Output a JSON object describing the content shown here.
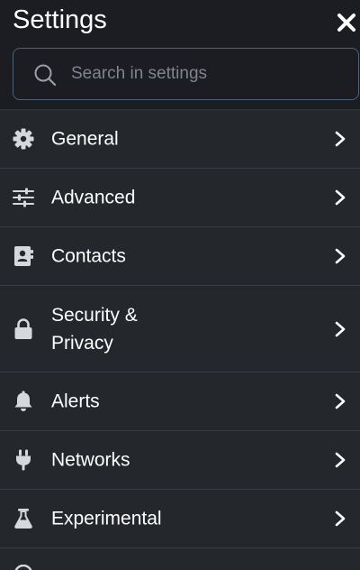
{
  "header": {
    "title": "Settings"
  },
  "search": {
    "placeholder": "Search in settings",
    "value": ""
  },
  "menu": {
    "items": [
      {
        "label": "General",
        "icon": "gear-icon"
      },
      {
        "label": "Advanced",
        "icon": "sliders-icon"
      },
      {
        "label": "Contacts",
        "icon": "address-book-icon"
      },
      {
        "label": "Security & Privacy",
        "icon": "lock-icon"
      },
      {
        "label": "Alerts",
        "icon": "bell-icon"
      },
      {
        "label": "Networks",
        "icon": "plug-icon"
      },
      {
        "label": "Experimental",
        "icon": "flask-icon"
      }
    ]
  },
  "colors": {
    "background": "#24272c",
    "header_background": "#1c1d22",
    "search_border": "#4f6172",
    "divider": "#3a3e44",
    "icon": "#d6d9dc",
    "placeholder": "#7f858c"
  }
}
